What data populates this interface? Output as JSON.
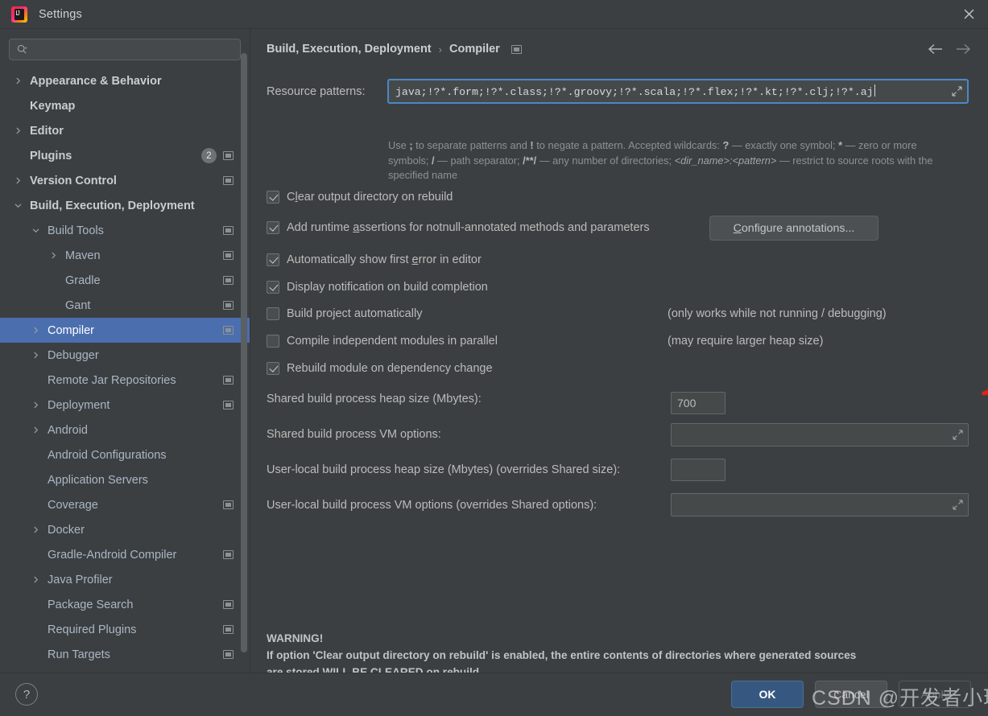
{
  "window": {
    "title": "Settings",
    "app_icon": "intellij-idea-icon",
    "close_icon": "close-icon"
  },
  "sidebar": {
    "search": {
      "placeholder": "",
      "value": "",
      "icon": "search-icon"
    },
    "items": [
      {
        "label": "Appearance & Behavior",
        "indent": 0,
        "arrow": "chevron-right",
        "bold": true,
        "badge": null,
        "modmark": false,
        "selected": false
      },
      {
        "label": "Keymap",
        "indent": 0,
        "arrow": "none",
        "bold": true,
        "badge": null,
        "modmark": false,
        "selected": false
      },
      {
        "label": "Editor",
        "indent": 0,
        "arrow": "chevron-right",
        "bold": true,
        "badge": null,
        "modmark": false,
        "selected": false
      },
      {
        "label": "Plugins",
        "indent": 0,
        "arrow": "none",
        "bold": true,
        "badge": "2",
        "modmark": true,
        "selected": false
      },
      {
        "label": "Version Control",
        "indent": 0,
        "arrow": "chevron-right",
        "bold": true,
        "badge": null,
        "modmark": true,
        "selected": false
      },
      {
        "label": "Build, Execution, Deployment",
        "indent": 0,
        "arrow": "chevron-down",
        "bold": true,
        "badge": null,
        "modmark": false,
        "selected": false
      },
      {
        "label": "Build Tools",
        "indent": 1,
        "arrow": "chevron-down",
        "bold": false,
        "badge": null,
        "modmark": true,
        "selected": false
      },
      {
        "label": "Maven",
        "indent": 2,
        "arrow": "chevron-right",
        "bold": false,
        "badge": null,
        "modmark": true,
        "selected": false
      },
      {
        "label": "Gradle",
        "indent": 2,
        "arrow": "none",
        "bold": false,
        "badge": null,
        "modmark": true,
        "selected": false
      },
      {
        "label": "Gant",
        "indent": 2,
        "arrow": "none",
        "bold": false,
        "badge": null,
        "modmark": true,
        "selected": false
      },
      {
        "label": "Compiler",
        "indent": 1,
        "arrow": "chevron-right",
        "bold": false,
        "badge": null,
        "modmark": true,
        "selected": true
      },
      {
        "label": "Debugger",
        "indent": 1,
        "arrow": "chevron-right",
        "bold": false,
        "badge": null,
        "modmark": false,
        "selected": false
      },
      {
        "label": "Remote Jar Repositories",
        "indent": 1,
        "arrow": "none",
        "bold": false,
        "badge": null,
        "modmark": true,
        "selected": false
      },
      {
        "label": "Deployment",
        "indent": 1,
        "arrow": "chevron-right",
        "bold": false,
        "badge": null,
        "modmark": true,
        "selected": false
      },
      {
        "label": "Android",
        "indent": 1,
        "arrow": "chevron-right",
        "bold": false,
        "badge": null,
        "modmark": false,
        "selected": false
      },
      {
        "label": "Android Configurations",
        "indent": 1,
        "arrow": "none",
        "bold": false,
        "badge": null,
        "modmark": false,
        "selected": false
      },
      {
        "label": "Application Servers",
        "indent": 1,
        "arrow": "none",
        "bold": false,
        "badge": null,
        "modmark": false,
        "selected": false
      },
      {
        "label": "Coverage",
        "indent": 1,
        "arrow": "none",
        "bold": false,
        "badge": null,
        "modmark": true,
        "selected": false
      },
      {
        "label": "Docker",
        "indent": 1,
        "arrow": "chevron-right",
        "bold": false,
        "badge": null,
        "modmark": false,
        "selected": false
      },
      {
        "label": "Gradle-Android Compiler",
        "indent": 1,
        "arrow": "none",
        "bold": false,
        "badge": null,
        "modmark": true,
        "selected": false
      },
      {
        "label": "Java Profiler",
        "indent": 1,
        "arrow": "chevron-right",
        "bold": false,
        "badge": null,
        "modmark": false,
        "selected": false
      },
      {
        "label": "Package Search",
        "indent": 1,
        "arrow": "none",
        "bold": false,
        "badge": null,
        "modmark": true,
        "selected": false
      },
      {
        "label": "Required Plugins",
        "indent": 1,
        "arrow": "none",
        "bold": false,
        "badge": null,
        "modmark": true,
        "selected": false
      },
      {
        "label": "Run Targets",
        "indent": 1,
        "arrow": "none",
        "bold": false,
        "badge": null,
        "modmark": true,
        "selected": false
      }
    ]
  },
  "main": {
    "breadcrumb": {
      "root": "Build, Execution, Deployment",
      "separator": "›",
      "leaf": "Compiler",
      "modmark_icon": "modified-marker-icon"
    },
    "nav": {
      "back_icon": "arrow-left-icon",
      "forward_icon": "arrow-right-icon"
    },
    "resource_patterns": {
      "label": "Resource patterns:",
      "value": "java;!?*.form;!?*.class;!?*.groovy;!?*.scala;!?*.flex;!?*.kt;!?*.clj;!?*.aj",
      "expand_icon": "expand-field-icon"
    },
    "hint_line1_a": "Use ",
    "hint_semicolon": ";",
    "hint_line1_b": " to separate patterns and ",
    "hint_bang": "!",
    "hint_line1_c": " to negate a pattern. Accepted wildcards: ",
    "hint_q": "?",
    "hint_line1_d": " — exactly one symbol; ",
    "hint_star": "*",
    "hint_line1_e": " — zero or more symbols; ",
    "hint_slash": "/",
    "hint_line1_f": " — path separator; ",
    "hint_globstar": "/**/",
    "hint_line1_g": " — any number of directories; ",
    "hint_dirname": "<dir_name>:<pattern>",
    "hint_line1_h": " — restrict to source roots with the specified name",
    "checkboxes": [
      {
        "label_pre": "C",
        "label_u": "l",
        "label_post": "ear output directory on rebuild",
        "checked": true
      },
      {
        "label_pre": "Add runtime ",
        "label_u": "a",
        "label_post": "ssertions for notnull-annotated methods and parameters",
        "checked": true
      },
      {
        "label_pre": "Automatically show first ",
        "label_u": "e",
        "label_post": "rror in editor",
        "checked": true
      },
      {
        "label_pre": "Display notification on build completion",
        "label_u": "",
        "label_post": "",
        "checked": true
      },
      {
        "label_pre": "Build project automatically",
        "label_u": "",
        "label_post": "",
        "checked": false
      },
      {
        "label_pre": "Compile independent modules in parallel",
        "label_u": "",
        "label_post": "",
        "checked": false
      },
      {
        "label_pre": "Rebuild module on dependency change",
        "label_u": "",
        "label_post": "",
        "checked": true
      }
    ],
    "configure_annotations": {
      "pre": "",
      "u": "C",
      "post": "onfigure annotations..."
    },
    "note_auto_build": "(only works while not running / debugging)",
    "note_parallel": "(may require larger heap size)",
    "fields": [
      {
        "label": "Shared build process heap size (Mbytes):",
        "value": "700",
        "expandable": false
      },
      {
        "label": "Shared build process VM options:",
        "value": "",
        "expandable": true
      },
      {
        "label": "User-local build process heap size (Mbytes) (overrides Shared size):",
        "value": "",
        "expandable": false
      },
      {
        "label": "User-local build process VM options (overrides Shared options):",
        "value": "",
        "expandable": true
      }
    ],
    "warning": {
      "title": "WARNING!",
      "line1": "If option 'Clear output directory on rebuild' is enabled, the entire contents of directories where generated sources",
      "line2": "are stored WILL BE CLEARED on rebuild."
    },
    "annotation": {
      "type": "red-arrow",
      "color": "#ee1c1c",
      "points_to": "shared-build-heap-size-field"
    }
  },
  "footer": {
    "help_label": "?",
    "ok_label": "OK",
    "cancel_label": "Cancel",
    "apply_label": "Apply"
  },
  "watermark": {
    "text": "CSDN @开发者小瑶"
  },
  "colors": {
    "background": "#3c3f41",
    "selection": "#4b6eaf",
    "focus_border": "#4a88c7",
    "primary_button": "#365880",
    "annotation_red": "#ee1c1c"
  }
}
